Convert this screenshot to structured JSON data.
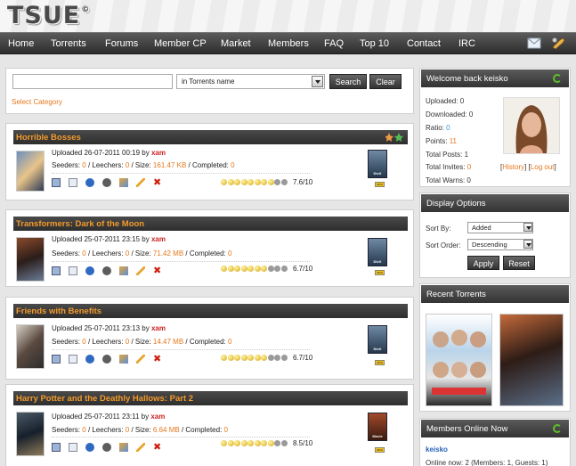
{
  "header": {
    "logo": "TSUE",
    "logo_mark": "©"
  },
  "nav": {
    "items": [
      "Home",
      "Torrents",
      "Forums",
      "Member CP",
      "Market",
      "Members",
      "FAQ",
      "Top 10",
      "Contact",
      "IRC"
    ],
    "icons": [
      "mail-icon",
      "tools-icon"
    ]
  },
  "search": {
    "input_value": "",
    "field_select": "in Torrents name",
    "search_label": "Search",
    "clear_label": "Clear",
    "select_category": "Select Category"
  },
  "torrents": [
    {
      "title": "Horrible Bosses",
      "uploaded": "Uploaded 26-07-2011 00:19 by",
      "uploader": "xam",
      "seeders": "0",
      "leechers": "0",
      "size": "161.47 KB",
      "completed": "0",
      "score": "7.6/10",
      "stars_full": 8,
      "stars_total": 10,
      "format": "DivX",
      "imdb": "IMDb"
    },
    {
      "title": "Transformers: Dark of the Moon",
      "uploaded": "Uploaded 25-07-2011 23:15 by",
      "uploader": "xam",
      "seeders": "0",
      "leechers": "0",
      "size": "71.42 MB",
      "completed": "0",
      "score": "6.7/10",
      "stars_full": 7,
      "stars_total": 10,
      "format": "DivX",
      "imdb": "IMDb"
    },
    {
      "title": "Friends with Benefits",
      "uploaded": "Uploaded 25-07-2011 23:13 by",
      "uploader": "xam",
      "seeders": "0",
      "leechers": "0",
      "size": "14.47 MB",
      "completed": "0",
      "score": "6.7/10",
      "stars_full": 7,
      "stars_total": 10,
      "format": "DivX",
      "imdb": "IMDb"
    },
    {
      "title": "Harry Potter and the Deathly Hallows: Part 2",
      "uploaded": "Uploaded 25-07-2011 23:11 by",
      "uploader": "xam",
      "seeders": "0",
      "leechers": "0",
      "size": "6.64 MB",
      "completed": "0",
      "score": "8.5/10",
      "stars_full": 8,
      "stars_total": 10,
      "format": "Movie",
      "imdb": "IMDb"
    }
  ],
  "labels": {
    "seeders": "Seeders:",
    "leechers": "Leechers:",
    "size": "Size:",
    "completed": "Completed:"
  },
  "welcome": {
    "title": "Welcome back keisko",
    "uploaded": "Uploaded: 0",
    "downloaded": "Downloaded: 0",
    "ratio_label": "Ratio:",
    "ratio_value": "0",
    "points_label": "Points:",
    "points_value": "11",
    "total_posts": "Total Posts: 1",
    "total_invites_label": "Total Invites:",
    "total_invites_value": "0",
    "total_warns": "Total Warns: 0",
    "history": "History",
    "logout": "Log out"
  },
  "display_options": {
    "title": "Display Options",
    "sort_by_label": "Sort By:",
    "sort_by_value": "Added",
    "sort_order_label": "Sort Order:",
    "sort_order_value": "Descending",
    "apply": "Apply",
    "reset": "Reset"
  },
  "recent": {
    "title": "Recent Torrents"
  },
  "online": {
    "title": "Members Online Now",
    "member": "keisko",
    "summary": "Online now: 2 (Members: 1, Guests: 1)"
  },
  "colors": {
    "accent": "#e5771e",
    "link_red": "#cc2222",
    "nav_bg": "#333333",
    "ratio_blue": "#3a9ad9"
  }
}
